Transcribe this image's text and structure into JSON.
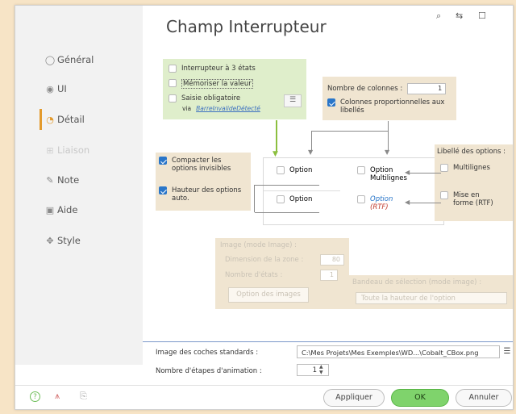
{
  "window": {
    "title": "Champ Interrupteur"
  },
  "toolbar": {
    "pin_icon": "⌕",
    "dock_icon": "⇆",
    "max_icon": "☐"
  },
  "sidebar": {
    "items": [
      {
        "label": "Général"
      },
      {
        "label": "UI"
      },
      {
        "label": "Détail"
      },
      {
        "label": "Liaison"
      },
      {
        "label": "Note"
      },
      {
        "label": "Aide"
      },
      {
        "label": "Style"
      }
    ]
  },
  "top_left_panel": {
    "tri_state": "Interrupteur à 3 états",
    "remember": "Mémoriser la valeur",
    "required": "Saisie obligatoire",
    "via": "via",
    "via_link": "BarreInvalideDétecté"
  },
  "columns_panel": {
    "label": "Nombre de colonnes :",
    "value": "1",
    "proportional": "Colonnes proportionnelles aux libellés"
  },
  "left_options_panel": {
    "compact": "Compacter les options invisibles",
    "auto_height": "Hauteur des options auto."
  },
  "preview": {
    "opt1": "Option",
    "opt2": "Option Multilignes",
    "opt3": "Option",
    "opt4": "Option",
    "opt4_sub": "(RTF)"
  },
  "labels_panel": {
    "title": "Libellé des options :",
    "multiline": "Multilignes",
    "formatted": "Mise en forme (RTF)"
  },
  "image_panel": {
    "title": "Image (mode Image) :",
    "zone_label": "Dimension de la zone :",
    "zone_value": "80",
    "states_label": "Nombre d'états :",
    "states_value": "1",
    "button": "Option des images"
  },
  "selection_panel": {
    "title": "Bandeau de sélection (mode image) :",
    "value": "Toute la hauteur de l'option"
  },
  "bottom": {
    "checks_label": "Image des coches standards :",
    "checks_path": "C:\\Mes Projets\\Mes Exemples\\WD...\\Cobalt_CBox.png",
    "anim_label": "Nombre d'étapes d'animation :",
    "anim_value": "1"
  },
  "footer": {
    "apply": "Appliquer",
    "ok": "OK",
    "cancel": "Annuler"
  }
}
